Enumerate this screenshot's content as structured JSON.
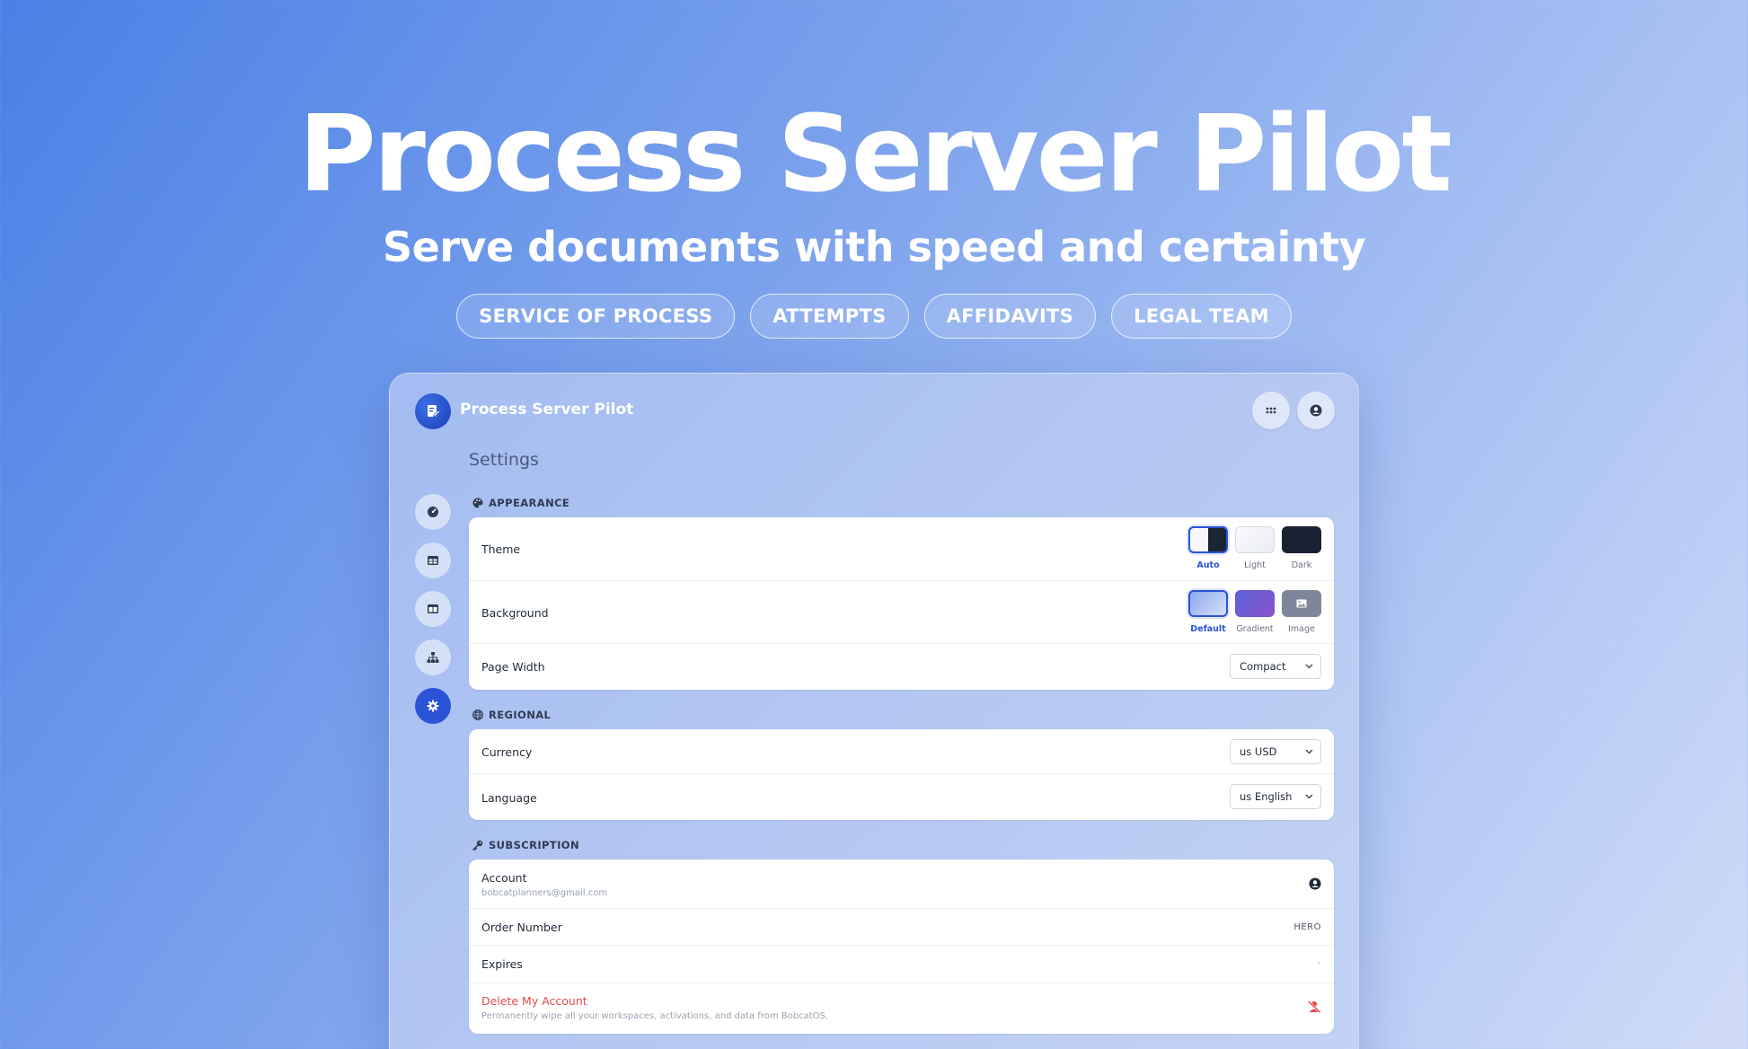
{
  "hero": {
    "title": "Process Server Pilot",
    "subtitle": "Serve documents with speed and certainty",
    "pills": [
      "SERVICE OF PROCESS",
      "ATTEMPTS",
      "AFFIDAVITS",
      "LEGAL TEAM"
    ]
  },
  "app": {
    "name": "Process Server Pilot",
    "page_title": "Settings"
  },
  "sections": {
    "appearance": {
      "label": "APPEARANCE",
      "theme_label": "Theme",
      "theme_options": [
        "Auto",
        "Light",
        "Dark"
      ],
      "theme_selected": "Auto",
      "background_label": "Background",
      "background_options": [
        "Default",
        "Gradient",
        "Image"
      ],
      "background_selected": "Default",
      "page_width_label": "Page Width",
      "page_width_value": "Compact"
    },
    "regional": {
      "label": "REGIONAL",
      "currency_label": "Currency",
      "currency_value": "us USD",
      "language_label": "Language",
      "language_value": "us English"
    },
    "subscription": {
      "label": "SUBSCRIPTION",
      "account_label": "Account",
      "account_email": "bobcatplanners@gmail.com",
      "order_label": "Order Number",
      "order_value": "HERO",
      "expires_label": "Expires",
      "expires_value": "-",
      "delete_label": "Delete My Account",
      "delete_desc": "Permanently wipe all your workspaces, activations, and data from BobcatOS."
    }
  },
  "colors": {
    "accent": "#2b53d6",
    "danger": "#e5484d"
  }
}
